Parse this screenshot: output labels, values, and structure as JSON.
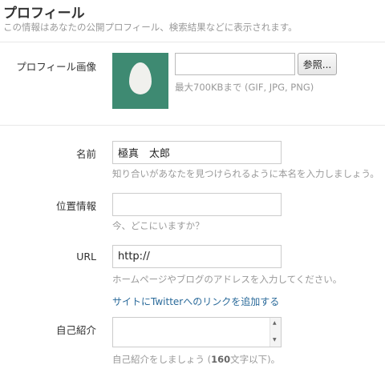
{
  "header": {
    "title": "プロフィール",
    "subtitle": "この情報はあなたの公開プロフィール、検索結果などに表示されます。"
  },
  "profile_image": {
    "label": "プロフィール画像",
    "browse_label": "参照...",
    "file_value": "",
    "hint": "最大700KBまで (GIF, JPG, PNG)",
    "avatar_color": "#3e8a72"
  },
  "name": {
    "label": "名前",
    "value": "極真　太郎",
    "hint": "知り合いがあなたを見つけられるように本名を入力しましょう。"
  },
  "location": {
    "label": "位置情報",
    "value": "",
    "hint": "今、どこにいますか？"
  },
  "url": {
    "label": "URL",
    "value": "http://",
    "hint": "ホームページやブログのアドレスを入力してください。",
    "link": "サイトにTwitterへのリンクを追加する"
  },
  "bio": {
    "label": "自己紹介",
    "value": "",
    "hint_prefix": "自己紹介をしましょう (",
    "hint_strong": "160",
    "hint_suffix": "文字以下)。"
  },
  "colors": {
    "link": "#2a6a9a",
    "hint": "#999999"
  }
}
